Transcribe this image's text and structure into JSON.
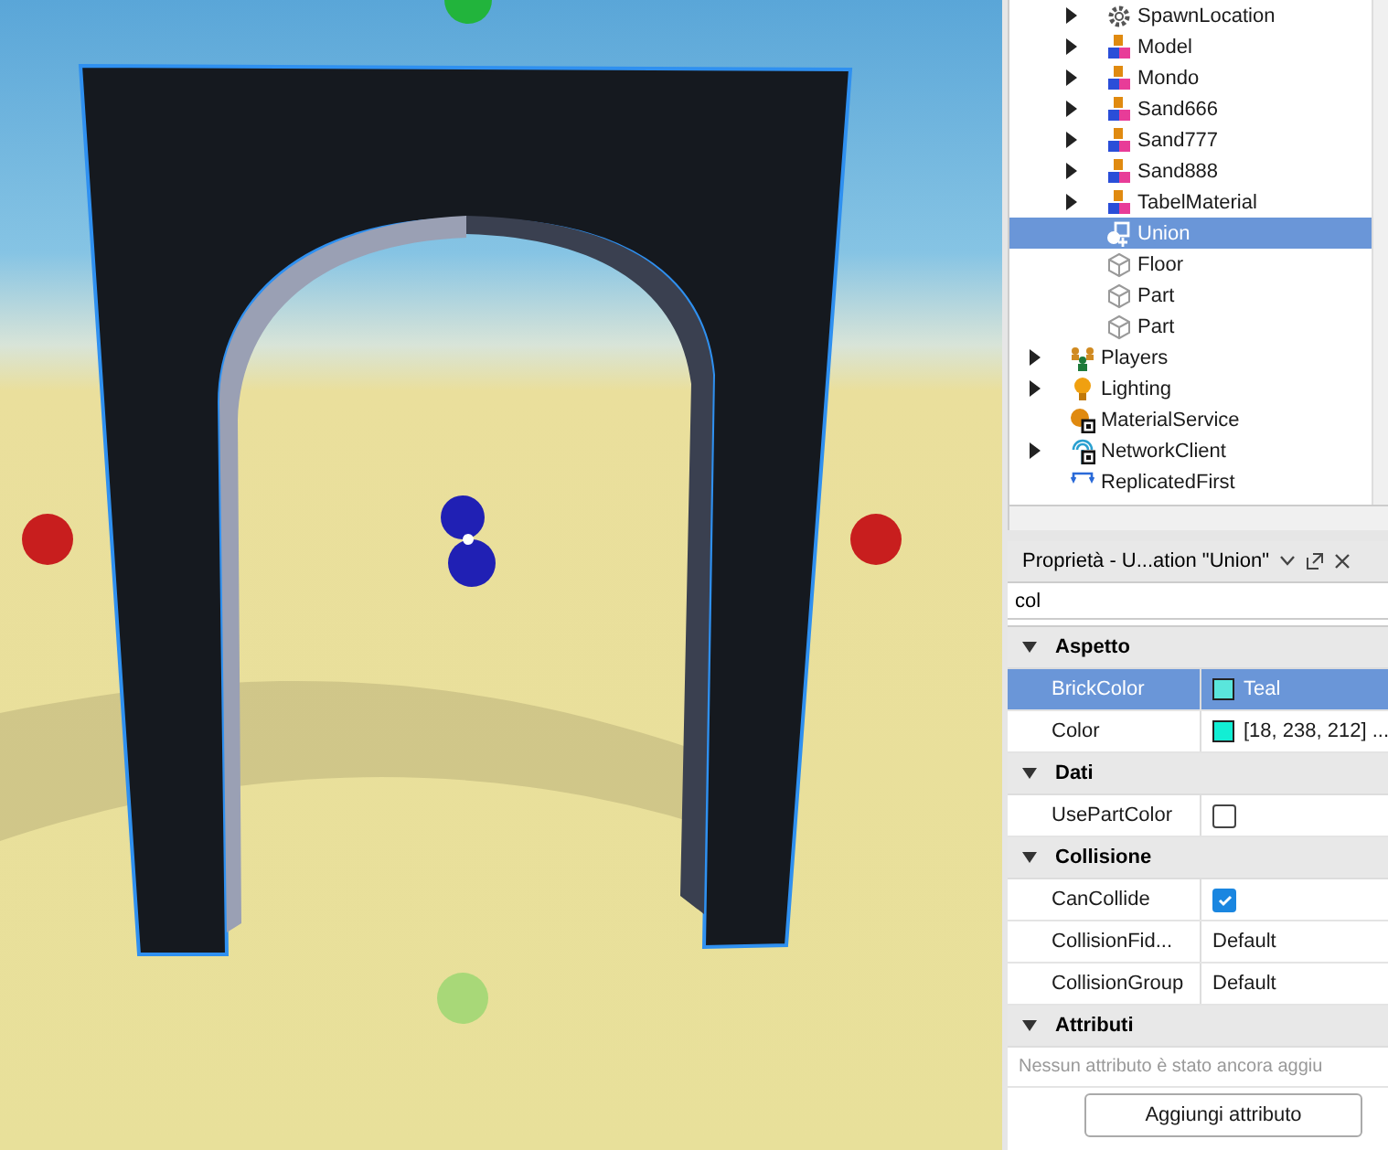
{
  "viewport": {
    "handles": [
      {
        "kind": "top",
        "color": "#22b43c"
      },
      {
        "kind": "left",
        "color": "#c81e1e"
      },
      {
        "kind": "right",
        "color": "#c81e1e"
      },
      {
        "kind": "bottom",
        "color": "#a8d878"
      },
      {
        "kind": "center",
        "color": "#2020b4"
      }
    ]
  },
  "explorer": {
    "tree": [
      {
        "children": [
          {
            "label": "SpawnLocation",
            "kind": "spawn",
            "expandable": true,
            "selected": false
          },
          {
            "label": "Model",
            "kind": "model",
            "expandable": true,
            "selected": false
          },
          {
            "label": "Mondo",
            "kind": "model",
            "expandable": true,
            "selected": false
          },
          {
            "label": "Sand666",
            "kind": "model",
            "expandable": true,
            "selected": false
          },
          {
            "label": "Sand777",
            "kind": "model",
            "expandable": true,
            "selected": false
          },
          {
            "label": "Sand888",
            "kind": "model",
            "expandable": true,
            "selected": false
          },
          {
            "label": "TabelMaterial",
            "kind": "model",
            "expandable": true,
            "selected": false
          },
          {
            "label": "Union",
            "kind": "union",
            "expandable": false,
            "selected": true
          },
          {
            "label": "Floor",
            "kind": "part",
            "expandable": false,
            "selected": false
          },
          {
            "label": "Part",
            "kind": "part",
            "expandable": false,
            "selected": false
          },
          {
            "label": "Part",
            "kind": "part",
            "expandable": false,
            "selected": false
          }
        ]
      },
      {
        "label": "Players",
        "kind": "players",
        "expandable": true,
        "selected": false
      },
      {
        "label": "Lighting",
        "kind": "lighting",
        "expandable": true,
        "selected": false
      },
      {
        "label": "MaterialService",
        "kind": "material",
        "expandable": false,
        "selected": false
      },
      {
        "label": "NetworkClient",
        "kind": "network",
        "expandable": true,
        "selected": false
      },
      {
        "label": "ReplicatedFirst",
        "kind": "replicated",
        "expandable": false,
        "selected": false
      }
    ]
  },
  "properties": {
    "title": "Proprietà - U...ation \"Union\"",
    "filter": "col",
    "sections": [
      {
        "title": "Aspetto",
        "expanded": true,
        "rows": [
          {
            "name": "BrickColor",
            "kind": "color",
            "value": "Teal",
            "color": "#5ae6dc",
            "selected": true
          },
          {
            "name": "Color",
            "kind": "color",
            "value": "[18, 238, 212] ...",
            "color": "#12eed4",
            "selected": false
          }
        ]
      },
      {
        "title": "Dati",
        "expanded": true,
        "rows": [
          {
            "name": "UsePartColor",
            "kind": "checkbox",
            "checked": false,
            "selected": false
          }
        ]
      },
      {
        "title": "Collisione",
        "expanded": true,
        "rows": [
          {
            "name": "CanCollide",
            "kind": "checkbox",
            "checked": true,
            "selected": false
          },
          {
            "name": "CollisionFid...",
            "kind": "text",
            "value": "Default",
            "selected": false
          },
          {
            "name": "CollisionGroup",
            "kind": "text",
            "value": "Default",
            "selected": false
          }
        ]
      },
      {
        "title": "Attributi",
        "expanded": true,
        "message": "Nessun attributo è stato ancora aggiu",
        "button": "Aggiungi attributo"
      }
    ]
  }
}
